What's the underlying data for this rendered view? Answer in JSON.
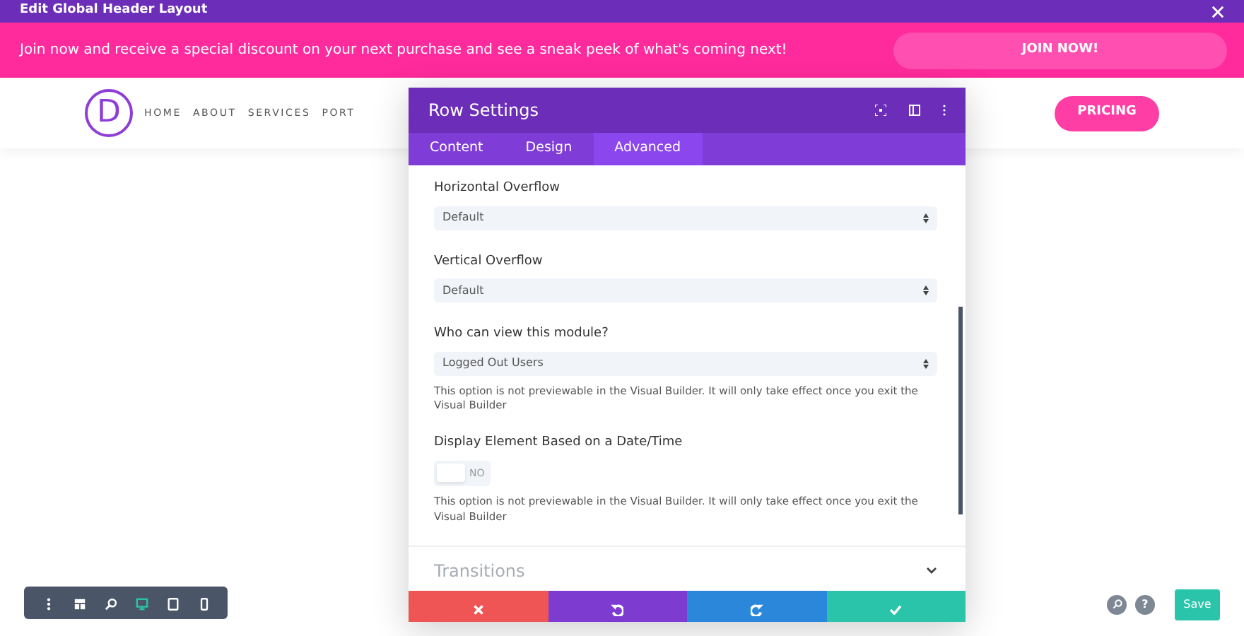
{
  "window": {
    "title": "Edit Global Header Layout"
  },
  "banner": {
    "text": "Join now and receive a special discount on your next purchase and see a sneak peek of what's coming next!",
    "button": "JOIN NOW!"
  },
  "header": {
    "logo": "D",
    "nav": [
      "HOME",
      "ABOUT",
      "SERVICES",
      "PORT"
    ],
    "button": "PRICING"
  },
  "modal": {
    "title": "Row Settings",
    "tabs": [
      {
        "label": "Content",
        "selected": false
      },
      {
        "label": "Design",
        "selected": false
      },
      {
        "label": "Advanced",
        "selected": true
      }
    ],
    "fields": [
      {
        "kind": "select",
        "label": "Horizontal Overflow",
        "value": "Default"
      },
      {
        "kind": "select",
        "label": "Vertical Overflow",
        "value": "Default"
      },
      {
        "kind": "select",
        "label": "Who can view this module?",
        "value": "Logged Out Users",
        "help": "This option is not previewable in the Visual Builder. It will only take effect once you exit the Visual Builder"
      },
      {
        "kind": "toggle",
        "label": "Display Element Based on a Date/Time",
        "on": false,
        "state_text": "NO",
        "help": "This option is not previewable in the Visual Builder. It will only take effect once you exit the Visual Builder"
      }
    ],
    "sections": [
      {
        "title": "Transitions",
        "expanded": false
      }
    ]
  },
  "toolbar": [
    {
      "kind": "menu",
      "selected": false
    },
    {
      "kind": "layout",
      "selected": false
    },
    {
      "kind": "zoom",
      "selected": false
    },
    {
      "kind": "desktop",
      "selected": true
    },
    {
      "kind": "tablet",
      "selected": false
    },
    {
      "kind": "phone",
      "selected": false
    }
  ],
  "bottom_right": {
    "help": "?",
    "save": "Save"
  }
}
